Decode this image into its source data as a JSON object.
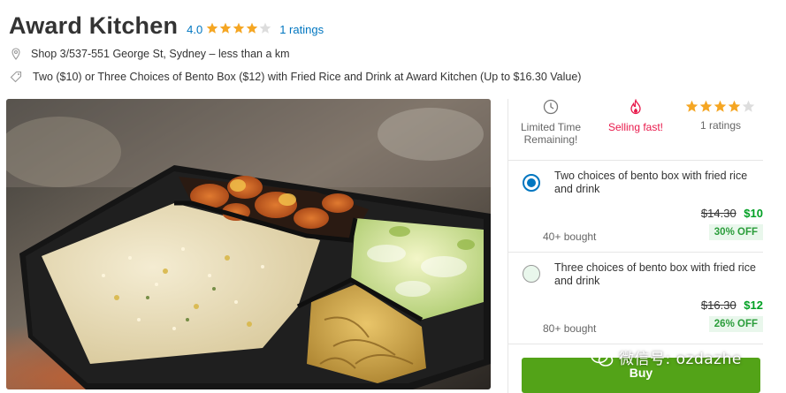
{
  "header": {
    "title": "Award Kitchen",
    "rating_value": "4.0",
    "rating_stars": 4,
    "ratings_text": "1 ratings"
  },
  "location": {
    "icon": "map-pin-icon",
    "text": "Shop 3/537-551 George St, Sydney – less than a km"
  },
  "deal": {
    "icon": "price-tag-icon",
    "text": "Two ($10) or Three Choices of Bento Box ($12) with Fried Rice and Drink at Award Kitchen (Up to $16.30 Value)"
  },
  "stats": {
    "limited": {
      "icon": "clock-icon",
      "label": "Limited Time Remaining!"
    },
    "selling": {
      "icon": "flame-icon",
      "label": "Selling fast!"
    },
    "rating": {
      "stars": 4,
      "label": "1 ratings"
    }
  },
  "options": [
    {
      "name": "Two choices of bento box with fried rice and drink",
      "old_price": "$14.30",
      "new_price": "$10",
      "bought": "40+ bought",
      "discount": "30% OFF",
      "selected": true
    },
    {
      "name": "Three choices of bento box with fried rice and drink",
      "old_price": "$16.30",
      "new_price": "$12",
      "bought": "80+ bought",
      "discount": "26% OFF",
      "selected": false
    }
  ],
  "buy_button": {
    "label": "Buy"
  },
  "watermark": {
    "icon": "wechat-icon",
    "text": "微信号: ozdazhe"
  },
  "colors": {
    "link": "#0076c0",
    "star": "#f5a623",
    "price_green": "#00a023",
    "buy_green": "#53a318",
    "hot_red": "#e8194b"
  }
}
